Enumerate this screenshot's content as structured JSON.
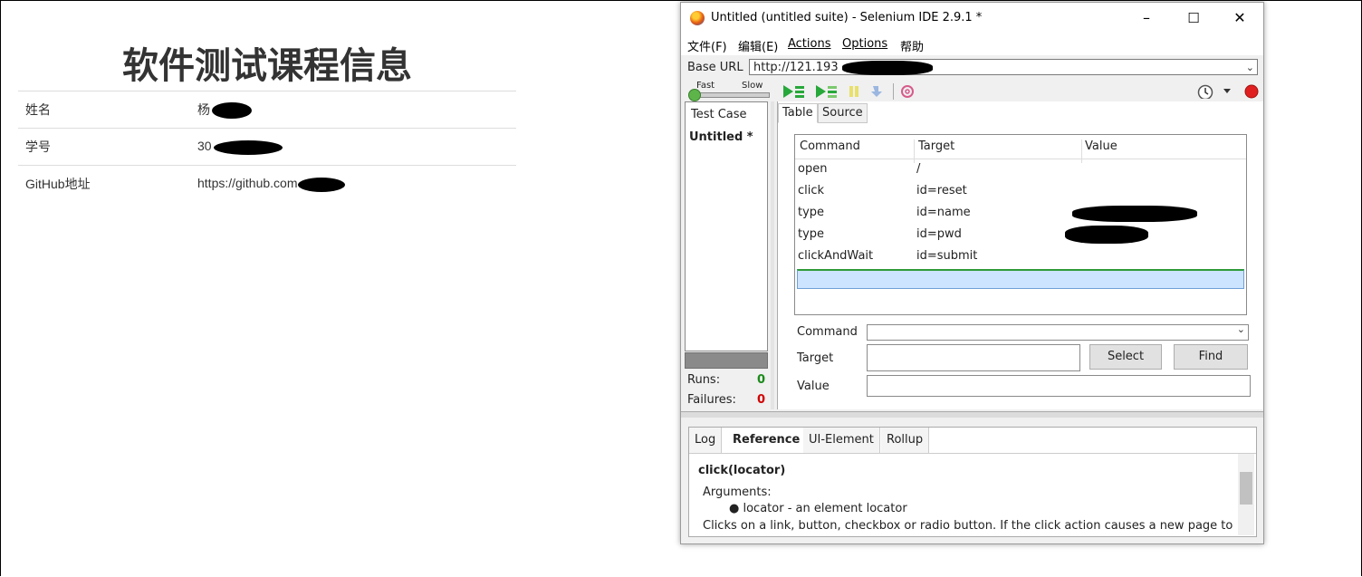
{
  "webpage": {
    "title": "软件测试课程信息",
    "rows": [
      {
        "label": "姓名",
        "value": "杨"
      },
      {
        "label": "学号",
        "value": "30"
      },
      {
        "label": "GitHub地址",
        "value": "https://github.com"
      }
    ]
  },
  "ide": {
    "window_title": "Untitled (untitled suite) - Selenium IDE 2.9.1 *",
    "window_controls": {
      "minimize": "–",
      "maximize": "☐",
      "close": "✕"
    },
    "menu": [
      "文件(F)",
      "编辑(E)",
      "Actions",
      "Options",
      "帮助"
    ],
    "base_url_label": "Base URL",
    "base_url_value": "http://121.193",
    "speed": {
      "fast": "Fast",
      "slow": "Slow"
    },
    "left_panel": {
      "header": "Test Case",
      "item": "Untitled *"
    },
    "stats": {
      "runs_label": "Runs:",
      "runs_value": "0",
      "failures_label": "Failures:",
      "failures_value": "0"
    },
    "tabs": [
      "Table",
      "Source"
    ],
    "table": {
      "headers": [
        "Command",
        "Target",
        "Value"
      ],
      "rows": [
        {
          "command": "open",
          "target": "/",
          "value": ""
        },
        {
          "command": "click",
          "target": "id=reset",
          "value": ""
        },
        {
          "command": "type",
          "target": "id=name",
          "value": ""
        },
        {
          "command": "type",
          "target": "id=pwd",
          "value": ""
        },
        {
          "command": "clickAndWait",
          "target": "id=submit",
          "value": ""
        }
      ]
    },
    "fields": {
      "command_label": "Command",
      "target_label": "Target",
      "value_label": "Value",
      "select_button": "Select",
      "find_button": "Find"
    },
    "bottom_tabs": [
      "Log",
      "Reference",
      "UI-Element",
      "Rollup"
    ],
    "reference": {
      "title": "click(locator)",
      "arguments_label": "Arguments:",
      "bullet": "locator - an element locator",
      "description": "Clicks on a link, button, checkbox or radio button. If the click action causes a new page to"
    },
    "colors": {
      "runs": "#1a8a1a",
      "failures": "#d00000",
      "record": "#e02020",
      "play": "#27a83a"
    }
  }
}
